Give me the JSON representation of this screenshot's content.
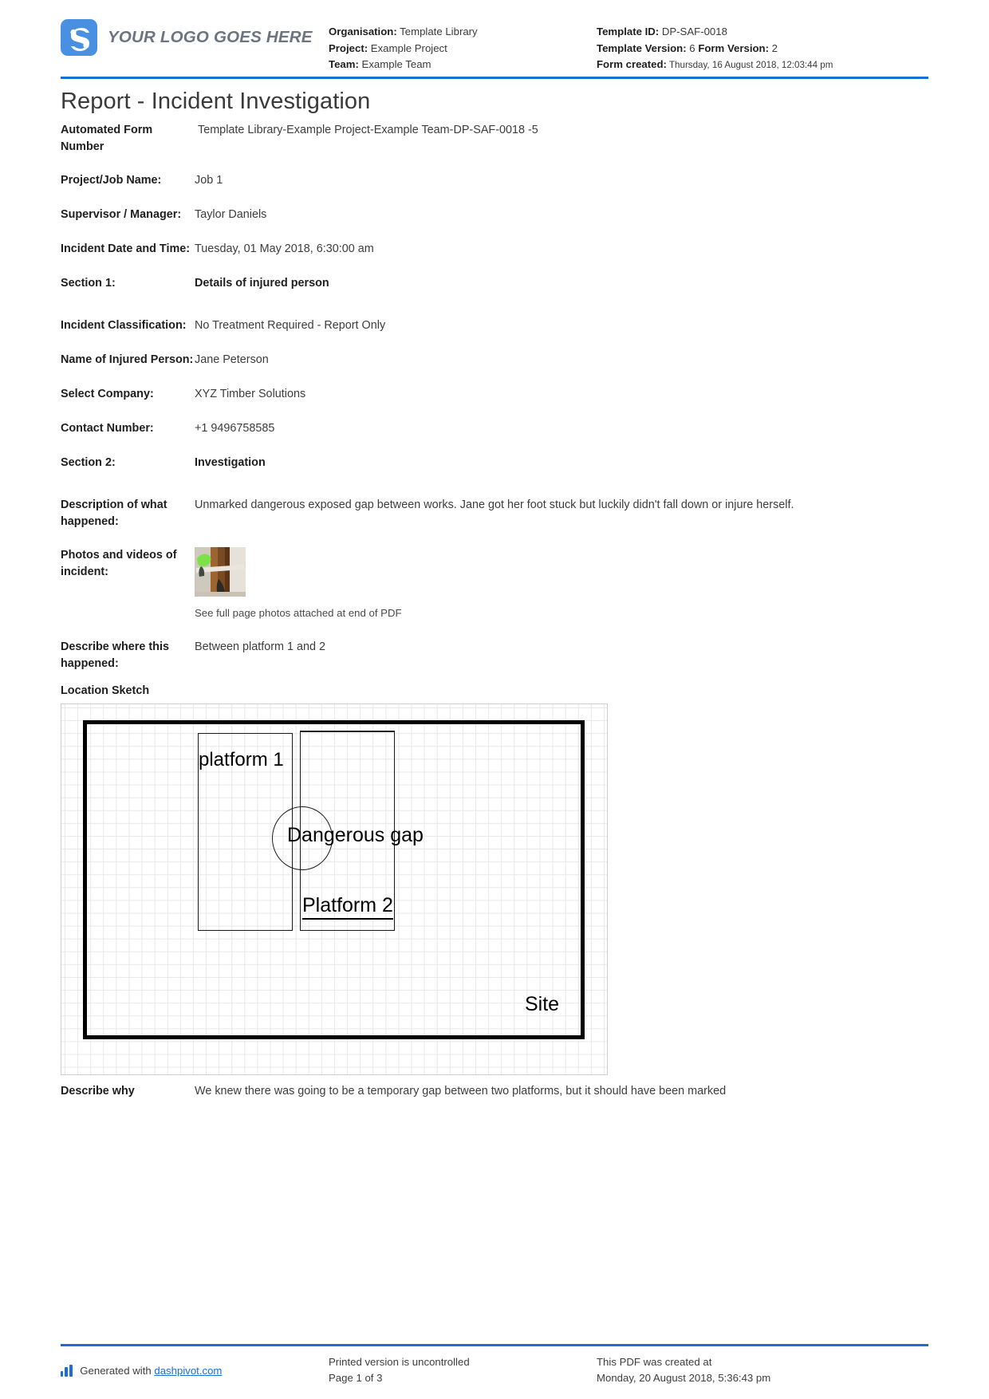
{
  "header": {
    "logo_text": "YOUR LOGO GOES HERE",
    "logo_color": "#4a90e2",
    "organisation_label": "Organisation:",
    "organisation_value": "Template Library",
    "project_label": "Project:",
    "project_value": "Example Project",
    "team_label": "Team:",
    "team_value": "Example Team",
    "template_id_label": "Template ID:",
    "template_id_value": "DP-SAF-0018",
    "template_version_label": "Template Version:",
    "template_version_value": "6",
    "form_version_label": "Form Version:",
    "form_version_value": "2",
    "form_created_label": "Form created:",
    "form_created_value": "Thursday, 16 August 2018, 12:03:44 pm",
    "accent_color": "#1a6fd4"
  },
  "document": {
    "title": "Report - Incident Investigation"
  },
  "fields": {
    "automated_form_number_label": "Automated Form Number",
    "automated_form_number_value": "Template Library-Example Project-Example Team-DP-SAF-0018   -5",
    "project_job_name_label": "Project/Job Name:",
    "project_job_name_value": "Job 1",
    "supervisor_label": "Supervisor / Manager:",
    "supervisor_value": "Taylor Daniels",
    "incident_datetime_label": "Incident Date and Time:",
    "incident_datetime_value": "Tuesday, 01 May 2018, 6:30:00 am",
    "section1_label": "Section 1:",
    "section1_value": "Details of injured person",
    "incident_classification_label": "Incident Classification:",
    "incident_classification_value": "No Treatment Required - Report Only",
    "injured_person_label": "Name of Injured Person:",
    "injured_person_value": "Jane Peterson",
    "select_company_label": "Select Company:",
    "select_company_value": "XYZ Timber Solutions",
    "contact_number_label": "Contact Number:",
    "contact_number_value": "+1 9496758585",
    "section2_label": "Section 2:",
    "section2_value": "Investigation",
    "description_label": "Description of what happened:",
    "description_value": "Unmarked dangerous exposed gap between works. Jane got her foot stuck but luckily didn't fall down or injure herself.",
    "photos_label": "Photos and videos of incident:",
    "photos_caption": "See full page photos attached at end of PDF",
    "where_label": "Describe where this happened:",
    "where_value": "Between platform 1 and 2",
    "location_sketch_label": "Location Sketch",
    "why_label": "Describe why",
    "why_value": "We knew there was going to be a temporary gap between two platforms, but it should have been marked"
  },
  "sketch": {
    "platform1_text": "platform 1",
    "dangerous_gap_text": "Dangerous gap",
    "platform2_text": "Platform 2",
    "site_text": "Site"
  },
  "footer": {
    "generated_prefix": "Generated with",
    "generated_link": "dashpivot.com",
    "printed_line1": "Printed version is uncontrolled",
    "printed_line2": "Page 1 of 3",
    "created_line1": "This PDF was created at",
    "created_line2": "Monday, 20 August 2018, 5:36:43 pm"
  }
}
